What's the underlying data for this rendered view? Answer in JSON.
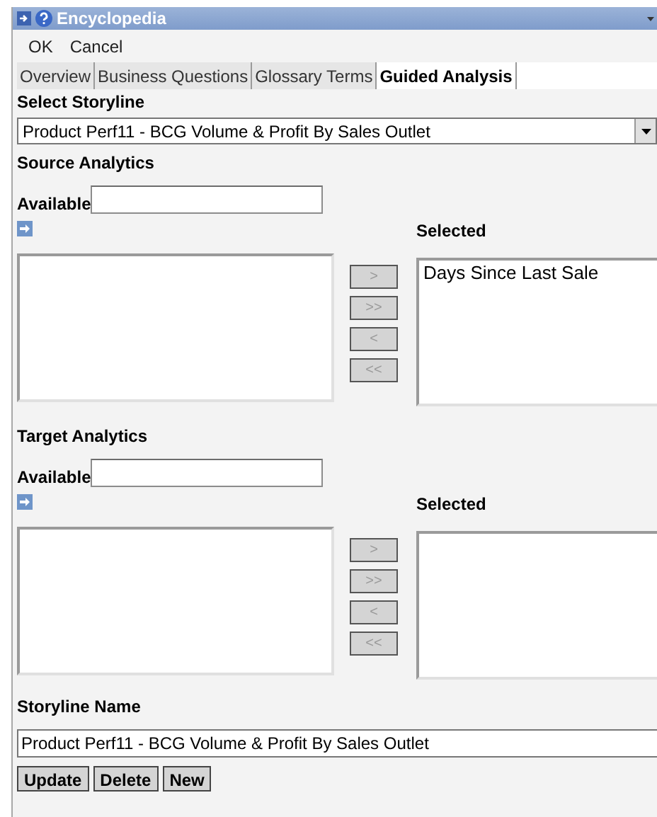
{
  "window": {
    "title": "Encyclopedia"
  },
  "menu": [
    "OK",
    "Cancel"
  ],
  "tabs": [
    {
      "label": "Overview",
      "selected": false
    },
    {
      "label": "Business Questions",
      "selected": false
    },
    {
      "label": "Glossary Terms",
      "selected": false
    },
    {
      "label": "Guided Analysis",
      "selected": true
    }
  ],
  "select_storyline": {
    "label": "Select Storyline",
    "value": "Product Perf11 - BCG Volume & Profit By Sales Outlet"
  },
  "sections": [
    {
      "title": "Source Analytics",
      "available_label": "Available",
      "selected_label": "Selected",
      "selected_items": [
        "Days Since Last Sale"
      ],
      "move_buttons": [
        {
          "label": ">",
          "disabled": true
        },
        {
          "label": ">>",
          "disabled": true
        },
        {
          "label": "<",
          "disabled": true
        },
        {
          "label": "<<",
          "disabled": true
        }
      ]
    },
    {
      "title": "Target Analytics",
      "available_label": "Available",
      "selected_label": "Selected",
      "move_buttons": [
        {
          "label": ">",
          "disabled": true
        },
        {
          "label": ">>",
          "disabled": true
        },
        {
          "label": "<",
          "disabled": true
        },
        {
          "label": "<<",
          "disabled": true
        }
      ]
    }
  ],
  "storyline_name": {
    "label": "Storyline Name",
    "value": "Product Perf11 - BCG Volume & Profit By Sales Outlet"
  },
  "buttons": [
    "Update",
    "Delete",
    "New"
  ]
}
